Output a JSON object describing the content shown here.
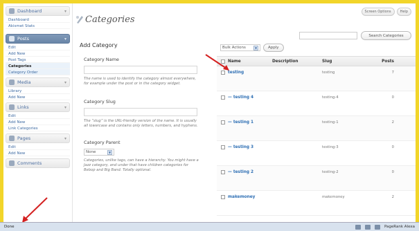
{
  "sidebar": {
    "dashboard": {
      "label": "Dashboard",
      "items": [
        "Dashboard",
        "Akismet Stats"
      ]
    },
    "posts": {
      "label": "Posts",
      "items": [
        "Edit",
        "Add New",
        "Post Tags",
        "Categories",
        "Category Order"
      ]
    },
    "media": {
      "label": "Media",
      "items": [
        "Library",
        "Add New"
      ]
    },
    "links": {
      "label": "Links",
      "items": [
        "Edit",
        "Add New",
        "Link Categories"
      ]
    },
    "pages": {
      "label": "Pages",
      "items": [
        "Edit",
        "Add New"
      ]
    },
    "comments": {
      "label": "Comments"
    }
  },
  "header": {
    "title": "Categories",
    "screen_options": "Screen Options",
    "help": "Help"
  },
  "search": {
    "button": "Search Categories",
    "value": ""
  },
  "add_form": {
    "title": "Add Category",
    "name_label": "Category Name",
    "name_help": "The name is used to identify the category almost everywhere, for example under the post or in the category widget.",
    "slug_label": "Category Slug",
    "slug_help": "The “slug” is the URL-friendly version of the name. It is usually all lowercase and contains only letters, numbers, and hyphens.",
    "parent_label": "Category Parent",
    "parent_value": "None",
    "parent_help": "Categories, unlike tags, can have a hierarchy. You might have a Jazz category, and under that have children categories for Bebop and Big Band. Totally optional."
  },
  "bulk": {
    "select": "Bulk Actions",
    "apply": "Apply"
  },
  "table": {
    "headers": {
      "name": "Name",
      "description": "Description",
      "slug": "Slug",
      "posts": "Posts"
    },
    "rows": [
      {
        "name": "testing",
        "slug": "testing",
        "posts": "7"
      },
      {
        "name": "— testing 4",
        "slug": "testing-4",
        "posts": "0"
      },
      {
        "name": "— testing 1",
        "slug": "testing-1",
        "posts": "2"
      },
      {
        "name": "— testing 3",
        "slug": "testing-3",
        "posts": "0"
      },
      {
        "name": "— testing 2",
        "slug": "testing-2",
        "posts": "0"
      },
      {
        "name": "makemoney",
        "slug": "makemoney",
        "posts": "2"
      }
    ]
  },
  "statusbar": {
    "left": "Done",
    "right": "PageRank  Alexa"
  },
  "colors": {
    "frame": "#f2d52a",
    "active_menu": "#6f8aab",
    "link": "#2e6fb4",
    "arrow": "#d42020"
  }
}
